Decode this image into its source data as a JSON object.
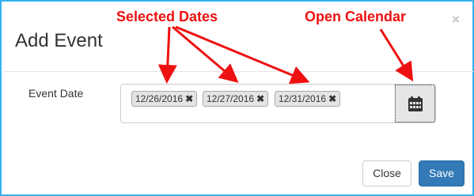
{
  "modal": {
    "title": "Add Event",
    "close_icon": "close-x-icon",
    "close_glyph": "×"
  },
  "field": {
    "label": "Event Date",
    "selected_dates": [
      {
        "value": "12/26/2016",
        "remove_glyph": "✖"
      },
      {
        "value": "12/27/2016",
        "remove_glyph": "✖"
      },
      {
        "value": "12/31/2016",
        "remove_glyph": "✖"
      }
    ],
    "calendar_icon": "calendar-icon"
  },
  "annotations": {
    "selected_dates": "Selected Dates",
    "open_calendar": "Open Calendar",
    "color": "#ee1111"
  },
  "footer": {
    "close_label": "Close",
    "save_label": "Save"
  },
  "colors": {
    "frame_border": "#37b2ee",
    "primary": "#337ab7",
    "chip_bg": "#e4e4e4"
  }
}
